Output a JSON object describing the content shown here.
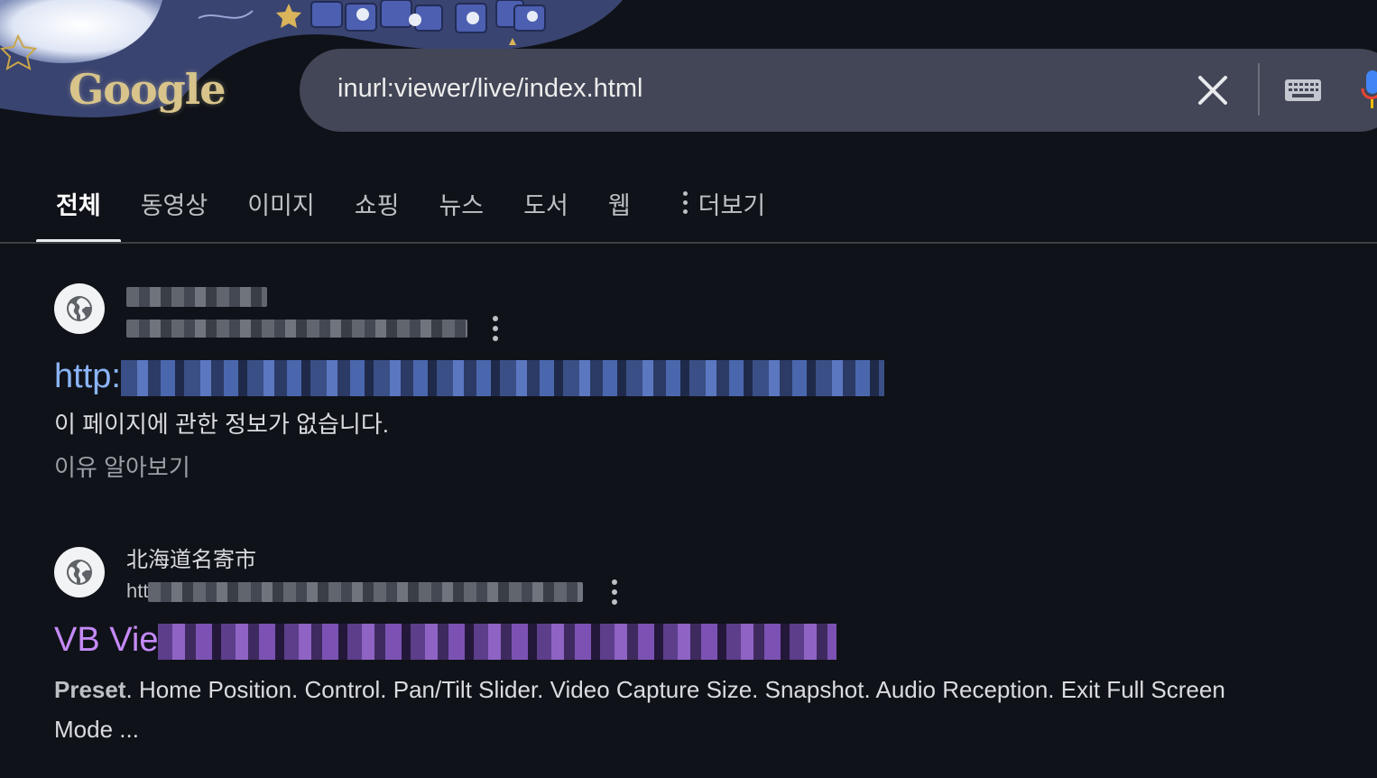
{
  "header": {
    "logo_text": "Google",
    "search_query": "inurl:viewer/live/index.html"
  },
  "tabs": [
    {
      "label": "전체",
      "active": true
    },
    {
      "label": "동영상"
    },
    {
      "label": "이미지"
    },
    {
      "label": "쇼핑"
    },
    {
      "label": "뉴스"
    },
    {
      "label": "도서"
    },
    {
      "label": "웹"
    },
    {
      "label": "더보기"
    }
  ],
  "results": [
    {
      "site_name": "",
      "url_prefix": "",
      "title_prefix": "http:",
      "snippet": "이 페이지에 관한 정보가 없습니다.",
      "learn_more": "이유 알아보기"
    },
    {
      "site_name": "北海道名寄市",
      "url_prefix": "htt",
      "title_prefix": "VB Vie",
      "snippet_bold": "Preset",
      "snippet": ". Home Position. Control. Pan/Tilt Slider. Video Capture Size. Snapshot. Audio Reception. Exit Full Screen Mode ..."
    }
  ],
  "colors": {
    "background": "#0f1218",
    "search_bar": "#424656",
    "link_blue": "#8ab4f8",
    "link_visited": "#c58af9"
  }
}
